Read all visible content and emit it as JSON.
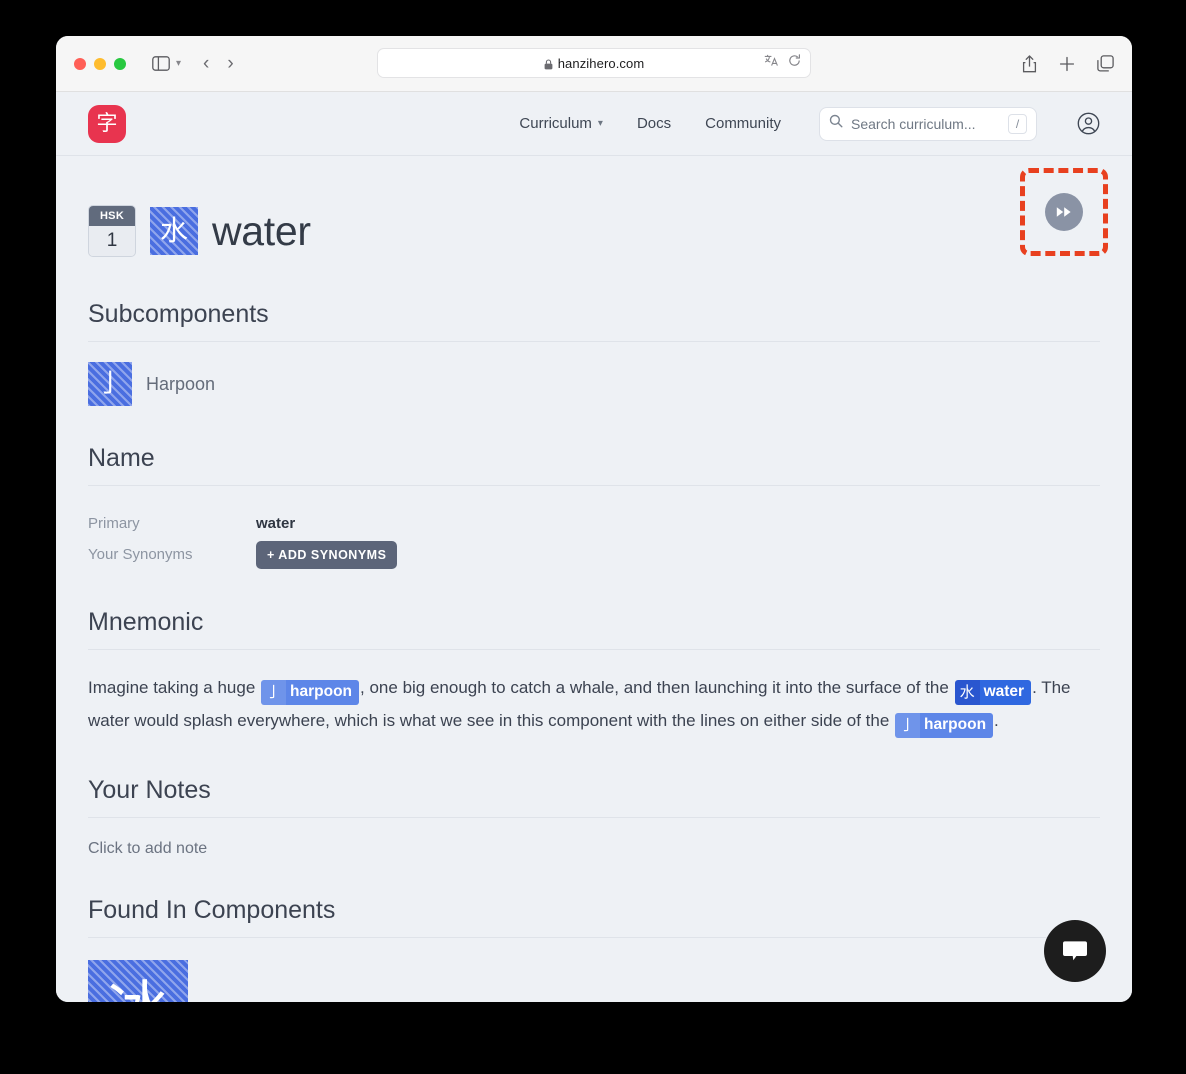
{
  "browser": {
    "url": "hanzihero.com",
    "traffic_lights": [
      "close",
      "minimize",
      "maximize"
    ],
    "icons": {
      "sidebar": "sidebar-icon",
      "back": "‹",
      "forward": "›",
      "lock": "lock-icon",
      "translate": "translate-icon",
      "reload": "reload-icon",
      "share": "share-icon",
      "new_tab": "+",
      "tabs": "tabs-icon"
    }
  },
  "site_header": {
    "logo_glyph": "字",
    "logo_color": "#e8344f",
    "nav": [
      {
        "label": "Curriculum",
        "has_chevron": true
      },
      {
        "label": "Docs",
        "has_chevron": false
      },
      {
        "label": "Community",
        "has_chevron": false
      }
    ],
    "search": {
      "placeholder": "Search curriculum...",
      "shortcut": "/"
    }
  },
  "page": {
    "hsk": {
      "label": "HSK",
      "level": "1"
    },
    "character": "水",
    "title": "water",
    "fast_forward_label": "▶▶",
    "sections": {
      "subcomponents": {
        "heading": "Subcomponents",
        "items": [
          {
            "glyph": "亅",
            "label": "Harpoon"
          }
        ]
      },
      "name": {
        "heading": "Name",
        "rows": [
          {
            "key": "Primary",
            "value": "water"
          },
          {
            "key": "Your Synonyms",
            "button": "+ ADD SYNONYMS"
          }
        ]
      },
      "mnemonic": {
        "heading": "Mnemonic",
        "text_1": "Imagine taking a huge ",
        "chip_1": {
          "glyph": "亅",
          "word": "harpoon"
        },
        "text_2": ", one big enough to catch a whale, and then launching it into the surface of the ",
        "chip_2": {
          "glyph": "水",
          "word": "water"
        },
        "text_3": ". The water would splash everywhere, which is what we see in this component with the lines on either side of the ",
        "chip_3": {
          "glyph": "亅",
          "word": "harpoon"
        },
        "text_4": "."
      },
      "notes": {
        "heading": "Your Notes",
        "placeholder": "Click to add note"
      },
      "found_in": {
        "heading": "Found In Components",
        "items": [
          {
            "glyph": "冰"
          }
        ]
      }
    },
    "annotation": {
      "color": "#e8401f",
      "target": "fast-forward-button"
    },
    "chat_fab": "chat-bubble-icon"
  }
}
